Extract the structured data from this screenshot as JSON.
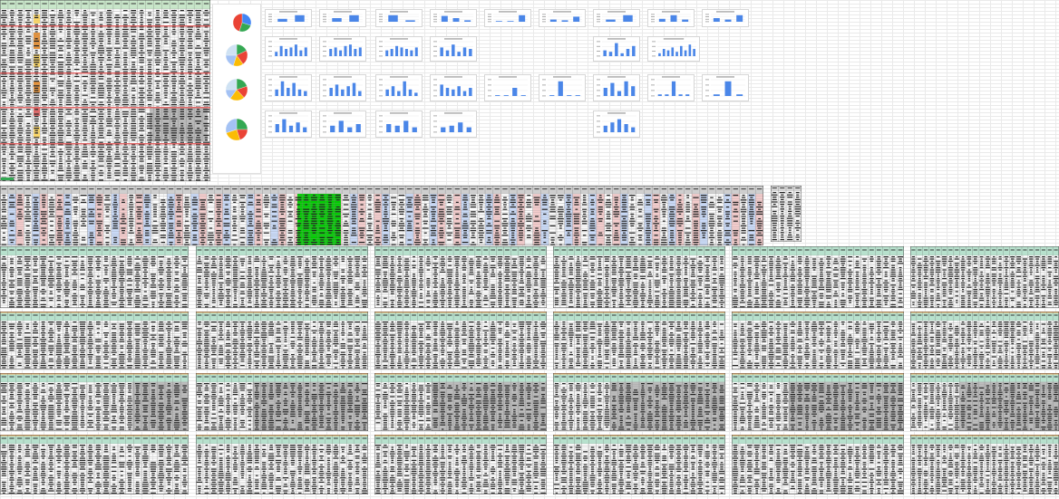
{
  "spreadsheet": {
    "sheet_type": "dense-dashboard",
    "colors": {
      "header_green": "#c8e6c9",
      "header_mint": "#b7e1cd",
      "row_pink": "#f4cccc",
      "row_blue": "#c9daf8",
      "highlight_green": "#00cc00",
      "highlight_yellow": "#ffd966",
      "highlight_orange": "#e69138",
      "highlight_red": "#e06666",
      "bar_blue": "#4a86e8",
      "gray_fill": "#bdbdbd",
      "dark_fill": "#111111",
      "orange_band": "#f6b26b"
    }
  },
  "pie_charts": [
    {
      "id": "pie1",
      "slices": [
        0.3,
        0.25,
        0.45
      ],
      "colors": [
        "#4285f4",
        "#34a853",
        "#ea4335"
      ]
    },
    {
      "id": "pie2",
      "slices": [
        0.18,
        0.22,
        0.15,
        0.2,
        0.25
      ],
      "colors": [
        "#34a853",
        "#ea4335",
        "#fbbc05",
        "#a4c2f4",
        "#cfe2f3"
      ]
    },
    {
      "id": "pie3",
      "slices": [
        0.2,
        0.18,
        0.22,
        0.15,
        0.25
      ],
      "colors": [
        "#34a853",
        "#ea4335",
        "#fbbc05",
        "#a4c2f4",
        "#cfe2f3"
      ]
    },
    {
      "id": "pie4",
      "slices": [
        0.25,
        0.2,
        0.25,
        0.3
      ],
      "colors": [
        "#34a853",
        "#ea4335",
        "#fbbc05",
        "#a4c2f4"
      ]
    }
  ],
  "bar_charts_row1": [
    {
      "values": [
        0.4,
        0.9
      ]
    },
    {
      "values": [
        0.5,
        0.9
      ]
    },
    {
      "values": [
        0.9,
        0.2
      ]
    },
    {
      "values": [
        0.8,
        0.5,
        0.2
      ]
    },
    {
      "values": [
        0.1,
        0.1,
        0.9
      ]
    },
    {
      "values": [
        0.3,
        0.2,
        0.7
      ]
    },
    {
      "values": [
        0.3,
        0.9
      ]
    },
    {
      "values": [
        0.4,
        0.9,
        0.3
      ]
    },
    {
      "values": [
        0.5,
        0.3,
        0.9
      ]
    }
  ],
  "bar_charts_row2": [
    {
      "values": [
        0.3,
        0.7,
        0.5,
        0.6,
        0.8,
        0.4,
        0.6
      ]
    },
    {
      "values": [
        0.5,
        0.6,
        0.4,
        0.7,
        0.8,
        0.5,
        0.6
      ]
    },
    {
      "values": [
        0.4,
        0.5,
        0.7,
        0.6,
        0.5,
        0.4,
        0.6
      ]
    },
    {
      "values": [
        0.6,
        0.4,
        0.8,
        0.3,
        0.6,
        0.5
      ]
    },
    {
      "values": [
        0.4,
        0.3,
        0.9,
        0.2,
        0.5,
        0.7
      ]
    },
    {
      "values": [
        0.2,
        0.5,
        0.4,
        0.6,
        0.3,
        0.7,
        0.4,
        0.8,
        0.5
      ]
    }
  ],
  "bar_charts_row3": [
    {
      "values": [
        0.4,
        0.9,
        0.5,
        0.8,
        0.4,
        0.3
      ]
    },
    {
      "values": [
        0.5,
        0.7,
        0.4,
        0.6,
        0.8,
        0.3
      ]
    },
    {
      "values": [
        0.4,
        0.6,
        0.3,
        0.9,
        0.4,
        0.2
      ]
    },
    {
      "values": [
        0.7,
        0.5,
        0.4,
        0.6,
        0.3,
        0.5
      ]
    },
    {
      "values": [
        0.05,
        0.05,
        0.5,
        0.05
      ]
    },
    {
      "values": [
        0.05,
        0.9,
        0.05,
        0.05
      ]
    },
    {
      "values": [
        0.5,
        0.8,
        0.3,
        0.9,
        0.6
      ]
    },
    {
      "values": [
        0.1,
        0.1,
        0.9,
        0.1,
        0.1
      ]
    },
    {
      "values": [
        0.1,
        0.9,
        0.1
      ]
    }
  ],
  "bar_charts_row4": [
    {
      "values": [
        0.5,
        0.8,
        0.4,
        0.6,
        0.3
      ]
    },
    {
      "values": [
        0.4,
        0.7,
        0.3,
        0.5
      ]
    },
    {
      "values": [
        0.5,
        0.4,
        0.7,
        0.3
      ]
    },
    {
      "values": [
        0.3,
        0.4,
        0.6,
        0.3
      ]
    },
    {
      "values": [
        0.4,
        0.6,
        0.8,
        0.5,
        0.3
      ]
    }
  ]
}
